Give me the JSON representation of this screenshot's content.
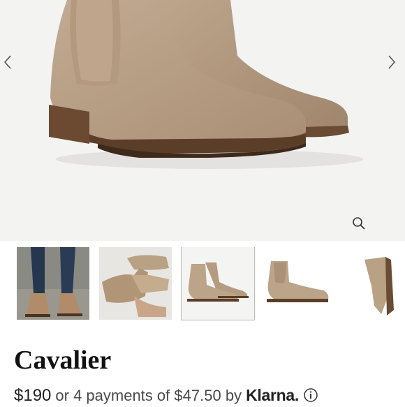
{
  "product": {
    "name": "Cavalier",
    "price": "$190",
    "installment_prefix": "or 4 payments of",
    "installment_amount": "$47.50",
    "installment_by": "by",
    "provider": "Klarna."
  },
  "gallery": {
    "prev_icon": "chevron-left-icon",
    "next_icon": "chevron-right-icon",
    "zoom_icon": "magnifier-icon",
    "selected_thumbnail": 3,
    "thumbnail_count": 5
  },
  "colors": {
    "suede": "#b29a80",
    "background": "#f3f3f2",
    "text": "#1a1a1a"
  }
}
